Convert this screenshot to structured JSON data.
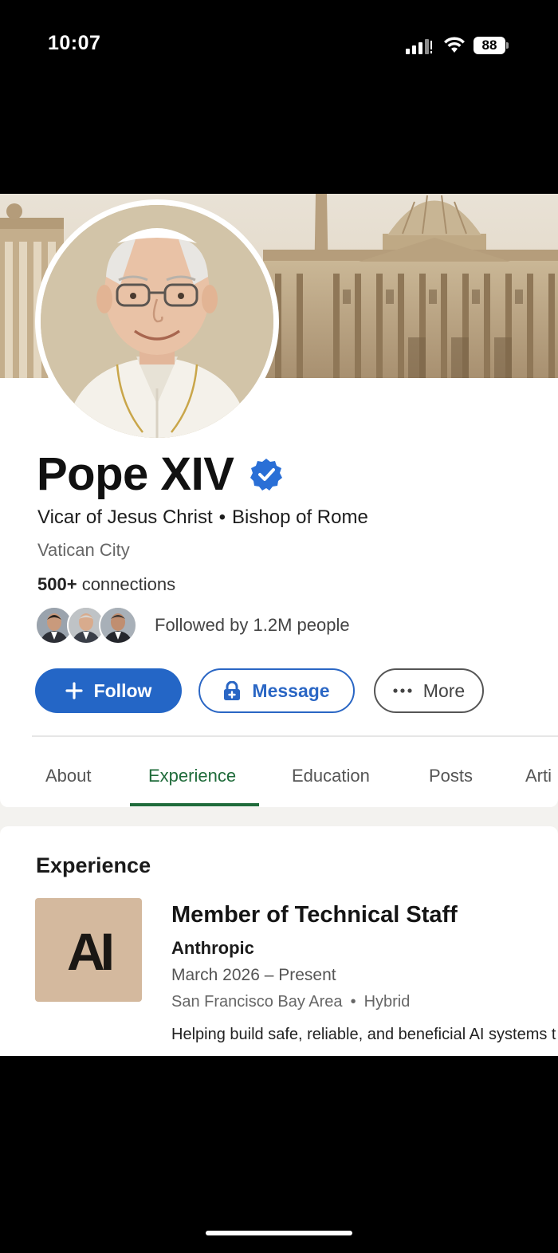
{
  "status_bar": {
    "time": "10:07",
    "battery": "88"
  },
  "profile": {
    "name": "Pope XIV",
    "headline_left": "Vicar of Jesus Christ",
    "headline_sep": "•",
    "headline_right": "Bishop of Rome",
    "location": "Vatican City",
    "connections_count": "500+",
    "connections_label": "connections",
    "followed_by": "Followed by 1.2M people"
  },
  "actions": {
    "follow_icon": "+",
    "follow_label": "Follow",
    "message_label": "Message",
    "more_icon": "•••",
    "more_label": "More"
  },
  "tabs": [
    {
      "label": "About",
      "active": false
    },
    {
      "label": "Experience",
      "active": true
    },
    {
      "label": "Education",
      "active": false
    },
    {
      "label": "Posts",
      "active": false
    },
    {
      "label": "Arti",
      "active": false
    }
  ],
  "experience": {
    "heading": "Experience",
    "items": [
      {
        "logo_text": "AI",
        "title": "Member of Technical Staff",
        "company": "Anthropic",
        "dates": "March 2026 – Present",
        "location": "San Francisco Bay Area",
        "location_sep": "•",
        "work_type": "Hybrid",
        "description": "Helping build safe, reliable, and beneficial AI systems t"
      }
    ]
  },
  "colors": {
    "brand_blue": "#2466c6",
    "active_tab": "#1f6b3a",
    "logo_bg": "#d4b99e",
    "verified": "#2a6fd6"
  },
  "icons": [
    "signal-icon",
    "wifi-icon",
    "battery-icon",
    "verified-badge-icon",
    "plus-icon",
    "lock-icon",
    "more-dots-icon"
  ]
}
